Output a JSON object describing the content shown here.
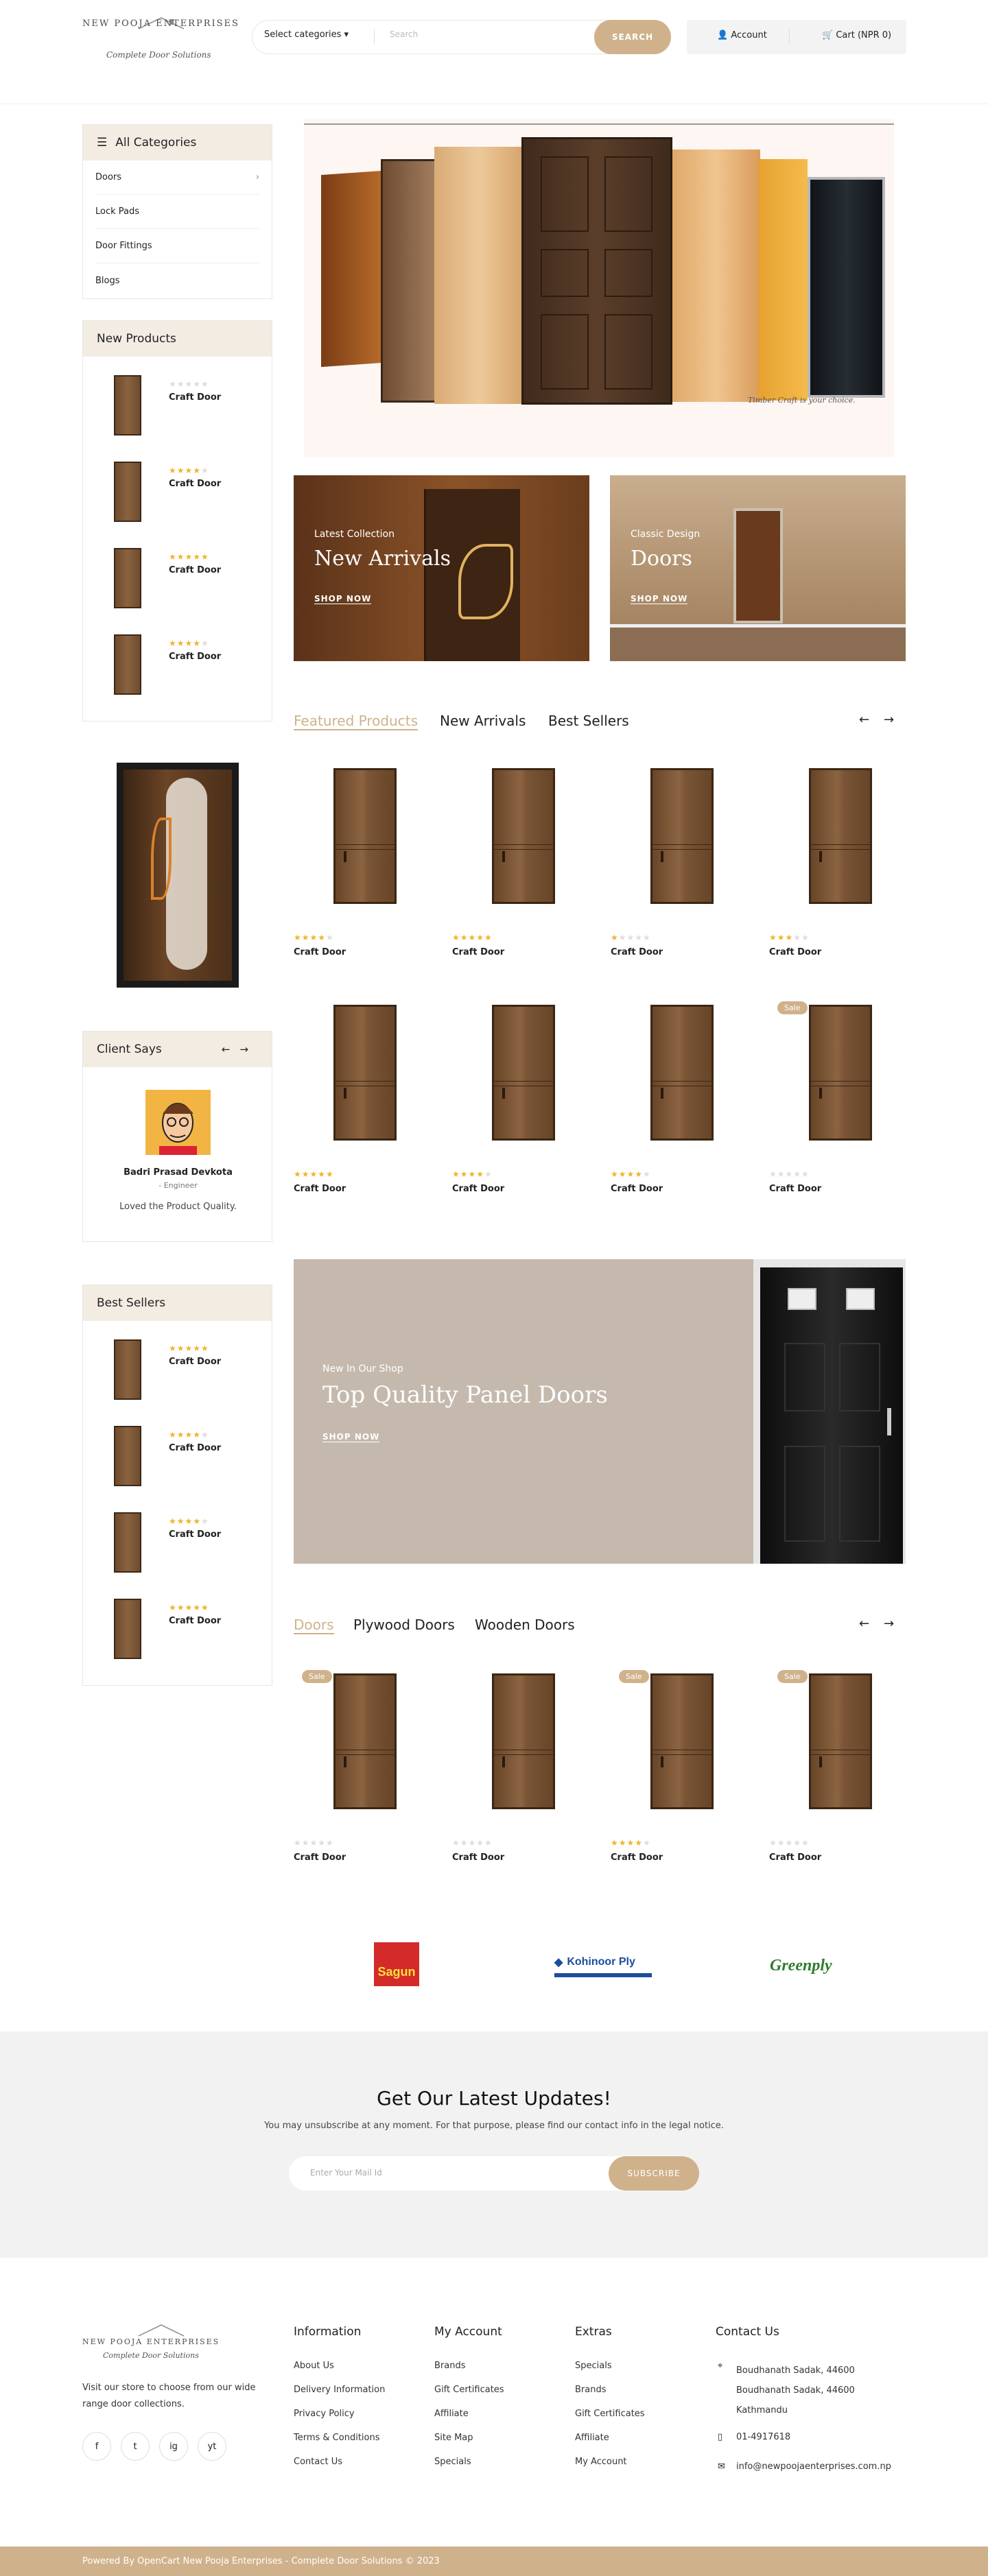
{
  "header": {
    "logo_main": "NEW POOJA ENTERPRISES",
    "logo_sub": "Complete Door Solutions",
    "category_select": "Select categories",
    "search_placeholder": "Search",
    "search_button": "SEARCH",
    "account": "Account",
    "cart": "Cart (NPR 0)"
  },
  "sidebar": {
    "categories_title": "All Categories",
    "categories": [
      "Doors",
      "Lock Pads",
      "Door Fittings",
      "Blogs"
    ],
    "new_products_title": "New Products",
    "new_products": [
      {
        "name": "Craft Door",
        "rating": 0
      },
      {
        "name": "Craft Door",
        "rating": 4
      },
      {
        "name": "Craft Door",
        "rating": 5
      },
      {
        "name": "Craft Door",
        "rating": 4
      }
    ],
    "client_says_title": "Client Says",
    "client_name": "Badri Prasad Devkota",
    "client_role": "- Engineer",
    "client_quote": "Loved the Product Quality.",
    "best_sellers_title": "Best Sellers",
    "best_sellers": [
      {
        "name": "Craft Door",
        "rating": 5
      },
      {
        "name": "Craft Door",
        "rating": 4
      },
      {
        "name": "Craft Door",
        "rating": 4
      },
      {
        "name": "Craft Door",
        "rating": 5
      }
    ]
  },
  "hero": {
    "caption": "Timber Craft is your choice."
  },
  "promos": [
    {
      "small": "Latest Collection",
      "big": "New Arrivals",
      "link": "SHOP NOW"
    },
    {
      "small": "Classic Design",
      "big": "Doors",
      "link": "SHOP NOW"
    }
  ],
  "featured": {
    "tabs": [
      "Featured Products",
      "New Arrivals",
      "Best Sellers"
    ],
    "products": [
      {
        "name": "Craft Door",
        "rating": 4,
        "sale": false
      },
      {
        "name": "Craft Door",
        "rating": 5,
        "sale": false
      },
      {
        "name": "Craft Door",
        "rating": 1,
        "sale": false
      },
      {
        "name": "Craft Door",
        "rating": 3,
        "sale": false
      },
      {
        "name": "Craft Door",
        "rating": 5,
        "sale": false
      },
      {
        "name": "Craft Door",
        "rating": 4,
        "sale": false
      },
      {
        "name": "Craft Door",
        "rating": 4,
        "sale": false
      },
      {
        "name": "Craft Door",
        "rating": 0,
        "sale": true
      }
    ]
  },
  "banner": {
    "small": "New In Our Shop",
    "big": "Top Quality Panel Doors",
    "link": "SHOP NOW"
  },
  "doors_section": {
    "tabs": [
      "Doors",
      "Plywood Doors",
      "Wooden Doors"
    ],
    "products": [
      {
        "name": "Craft Door",
        "rating": 0,
        "sale": true
      },
      {
        "name": "Craft Door",
        "rating": 0,
        "sale": false
      },
      {
        "name": "Craft Door",
        "rating": 4,
        "sale": true
      },
      {
        "name": "Craft Door",
        "rating": 0,
        "sale": true
      }
    ]
  },
  "sale_label": "Sale",
  "brands": [
    "Sagun",
    "Kohinoor Ply",
    "Greenply"
  ],
  "newsletter": {
    "title": "Get Our Latest Updates!",
    "text": "You may unsubscribe at any moment. For that purpose, please find our contact info in the legal notice.",
    "placeholder": "Enter Your Mail Id",
    "button": "SUBSCRIBE"
  },
  "footer": {
    "about": "Visit our store to choose from our wide range door collections.",
    "info_title": "Information",
    "info": [
      "About Us",
      "Delivery Information",
      "Privacy Policy",
      "Terms & Conditions",
      "Contact Us"
    ],
    "account_title": "My Account",
    "account": [
      "Brands",
      "Gift Certificates",
      "Affiliate",
      "Site Map",
      "Specials"
    ],
    "extras_title": "Extras",
    "extras": [
      "Specials",
      "Brands",
      "Gift Certificates",
      "Affiliate",
      "My Account"
    ],
    "contact_title": "Contact Us",
    "address1": "Boudhanath Sadak, 44600",
    "address2": "Boudhanath Sadak, 44600",
    "address3": "Kathmandu",
    "phone": "01-4917618",
    "email": "info@newpoojaenterprises.com.np",
    "social": [
      "f",
      "t",
      "ig",
      "yt"
    ],
    "copyright": "Powered By OpenCart New Pooja Enterprises - Complete Door Solutions © 2023"
  },
  "colors": {
    "accent": "#cfb28b",
    "star": "#f0b429",
    "box_header": "#f2ece3"
  }
}
